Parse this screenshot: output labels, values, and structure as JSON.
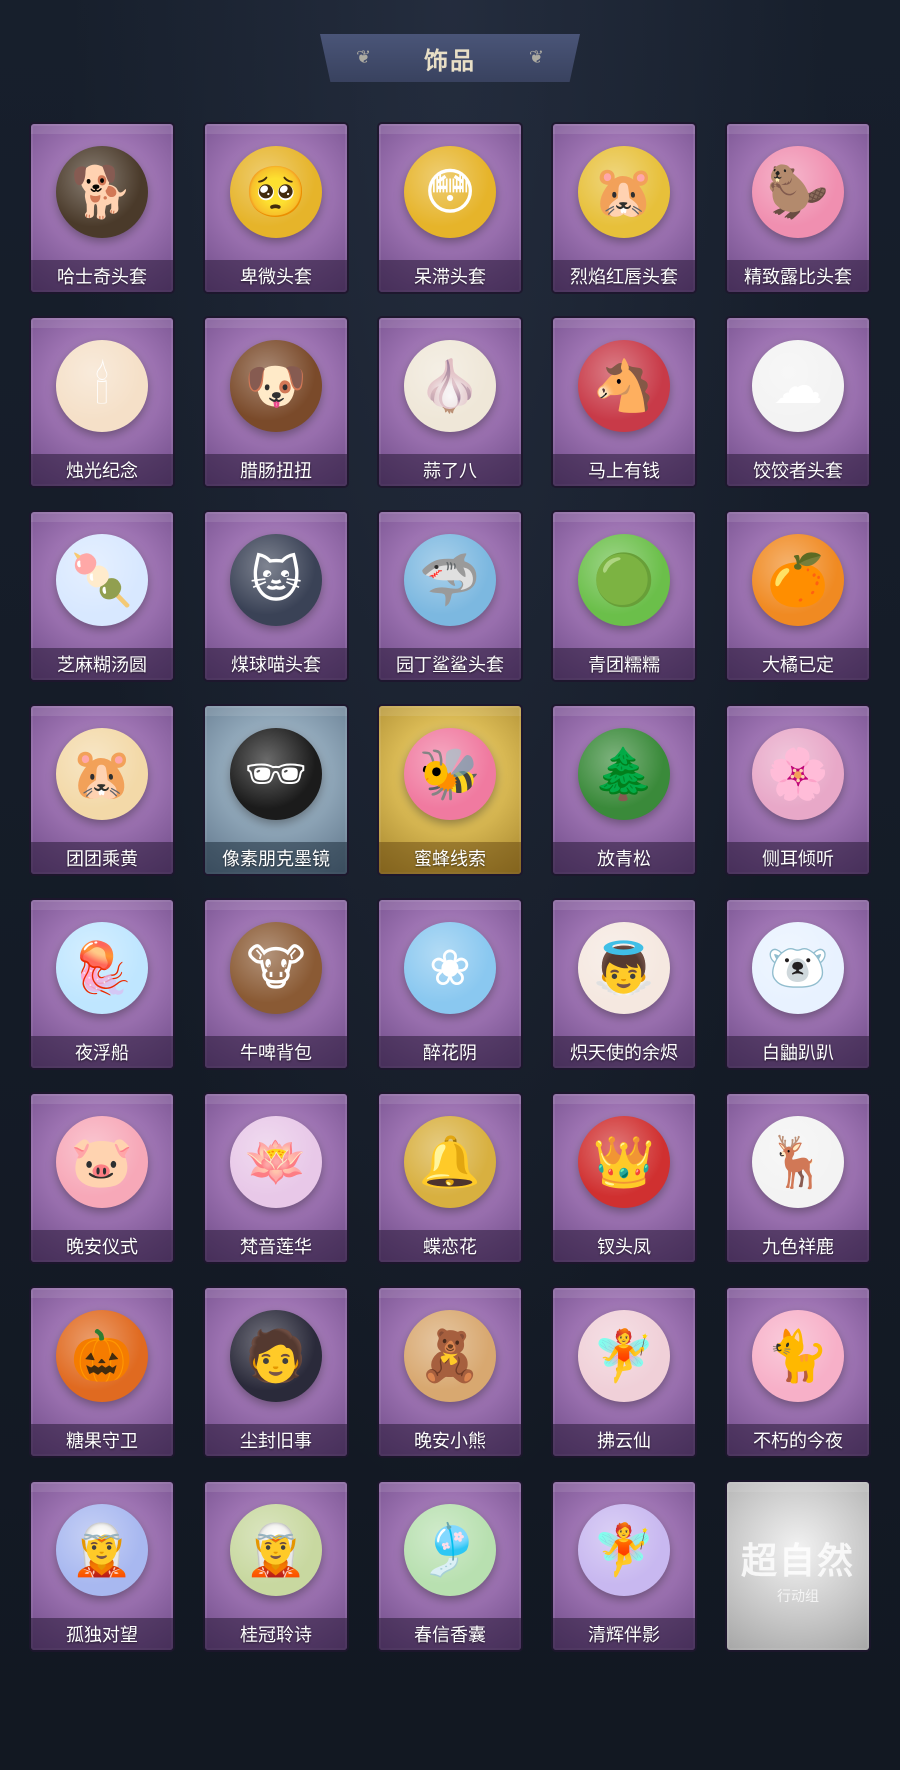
{
  "header": {
    "title": "饰品"
  },
  "items": [
    {
      "label": "哈士奇头套",
      "icon": "husky-head-icon",
      "glyph": "🐕",
      "tint": "#4a3a2a",
      "rarity": "purple"
    },
    {
      "label": "卑微头套",
      "icon": "humble-face-icon",
      "glyph": "🥺",
      "tint": "#e6b42a",
      "rarity": "purple"
    },
    {
      "label": "呆滞头套",
      "icon": "dazed-face-icon",
      "glyph": "😳",
      "tint": "#e6b42a",
      "rarity": "purple"
    },
    {
      "label": "烈焰红唇头套",
      "icon": "red-lips-head-icon",
      "glyph": "🐹",
      "tint": "#e7c03a",
      "rarity": "purple"
    },
    {
      "label": "精致露比头套",
      "icon": "loopy-head-icon",
      "glyph": "🦫",
      "tint": "#f08fb0",
      "rarity": "purple"
    },
    {
      "label": "烛光纪念",
      "icon": "candle-icon",
      "glyph": "🕯",
      "tint": "#f5e0c8",
      "rarity": "purple"
    },
    {
      "label": "腊肠扭扭",
      "icon": "dachshund-icon",
      "glyph": "🐶",
      "tint": "#7a4a2a",
      "rarity": "purple"
    },
    {
      "label": "蒜了八",
      "icon": "garlic-icon",
      "glyph": "🧄",
      "tint": "#efe7d8",
      "rarity": "purple"
    },
    {
      "label": "马上有钱",
      "icon": "horse-icon",
      "glyph": "🐴",
      "tint": "#c83a48",
      "rarity": "purple"
    },
    {
      "label": "饺饺者头套",
      "icon": "dumpling-head-icon",
      "glyph": "☁",
      "tint": "#f3f3f3",
      "rarity": "purple"
    },
    {
      "label": "芝麻糊汤圆",
      "icon": "tangyuan-icon",
      "glyph": "🍡",
      "tint": "#d8e8ff",
      "rarity": "purple"
    },
    {
      "label": "煤球喵头套",
      "icon": "cat-head-icon",
      "glyph": "🐱",
      "tint": "#3a4256",
      "rarity": "purple"
    },
    {
      "label": "园丁鲨鲨头套",
      "icon": "shark-head-icon",
      "glyph": "🦈",
      "tint": "#7cb8e0",
      "rarity": "purple"
    },
    {
      "label": "青团糯糯",
      "icon": "green-dumpling-icon",
      "glyph": "🟢",
      "tint": "#6bbf4a",
      "rarity": "purple"
    },
    {
      "label": "大橘已定",
      "icon": "orange-slice-icon",
      "glyph": "🍊",
      "tint": "#f08a22",
      "rarity": "purple"
    },
    {
      "label": "团团乘黄",
      "icon": "fluffy-beast-icon",
      "glyph": "🐹",
      "tint": "#f3d9a8",
      "rarity": "purple"
    },
    {
      "label": "像素朋克墨镜",
      "icon": "pixel-sunglasses-icon",
      "glyph": "🕶",
      "tint": "#1b1b1b",
      "rarity": "blue"
    },
    {
      "label": "蜜蜂线索",
      "icon": "bee-loopy-icon",
      "glyph": "🐝",
      "tint": "#f07aa0",
      "rarity": "gold"
    },
    {
      "label": "放青松",
      "icon": "bonsai-pine-icon",
      "glyph": "🌲",
      "tint": "#3a8a3a",
      "rarity": "purple"
    },
    {
      "label": "侧耳倾听",
      "icon": "flower-wreath-icon",
      "glyph": "🌸",
      "tint": "#e8a8c8",
      "rarity": "purple"
    },
    {
      "label": "夜浮船",
      "icon": "jellyfish-icon",
      "glyph": "🪼",
      "tint": "#bfe6ff",
      "rarity": "purple"
    },
    {
      "label": "牛啤背包",
      "icon": "cow-barrel-icon",
      "glyph": "🐮",
      "tint": "#8a5a34",
      "rarity": "purple"
    },
    {
      "label": "醉花阴",
      "icon": "ornament-fan-icon",
      "glyph": "❀",
      "tint": "#8ac8f0",
      "rarity": "purple"
    },
    {
      "label": "炽天使的余烬",
      "icon": "angel-doll-icon",
      "glyph": "👼",
      "tint": "#f5e8e0",
      "rarity": "purple"
    },
    {
      "label": "白鼬趴趴",
      "icon": "ermine-plush-icon",
      "glyph": "🐻‍❄",
      "tint": "#e8f2ff",
      "rarity": "purple"
    },
    {
      "label": "晚安仪式",
      "icon": "sleepy-pig-icon",
      "glyph": "🐷",
      "tint": "#f7a8b8",
      "rarity": "purple"
    },
    {
      "label": "梵音莲华",
      "icon": "lotus-doll-icon",
      "glyph": "🪷",
      "tint": "#e8c8e8",
      "rarity": "purple"
    },
    {
      "label": "蝶恋花",
      "icon": "butterfly-bell-icon",
      "glyph": "🔔",
      "tint": "#d8b040",
      "rarity": "purple"
    },
    {
      "label": "钗头凤",
      "icon": "phoenix-crown-icon",
      "glyph": "👑",
      "tint": "#d03030",
      "rarity": "purple"
    },
    {
      "label": "九色祥鹿",
      "icon": "deer-icon",
      "glyph": "🦌",
      "tint": "#f3f3f3",
      "rarity": "purple"
    },
    {
      "label": "糖果守卫",
      "icon": "pumpkin-guard-icon",
      "glyph": "🎃",
      "tint": "#e06a20",
      "rarity": "purple"
    },
    {
      "label": "尘封旧事",
      "icon": "boy-doll-icon",
      "glyph": "🧑",
      "tint": "#2a2a3a",
      "rarity": "purple"
    },
    {
      "label": "晚安小熊",
      "icon": "bear-charm-icon",
      "glyph": "🧸",
      "tint": "#d8a870",
      "rarity": "purple"
    },
    {
      "label": "拂云仙",
      "icon": "fairy-charm-icon",
      "glyph": "🧚",
      "tint": "#f0d0d8",
      "rarity": "purple"
    },
    {
      "label": "不朽的今夜",
      "icon": "pink-cat-cup-icon",
      "glyph": "🐈",
      "tint": "#f7b0c8",
      "rarity": "purple"
    },
    {
      "label": "孤独对望",
      "icon": "blue-doll-icon",
      "glyph": "🧝",
      "tint": "#a8b8f0",
      "rarity": "purple"
    },
    {
      "label": "桂冠聆诗",
      "icon": "laurel-doll-icon",
      "glyph": "🧝",
      "tint": "#c8d8a0",
      "rarity": "purple"
    },
    {
      "label": "春信香囊",
      "icon": "sachet-icon",
      "glyph": "🎐",
      "tint": "#b8e0b0",
      "rarity": "purple"
    },
    {
      "label": "清辉伴影",
      "icon": "moon-doll-icon",
      "glyph": "🧚",
      "tint": "#c8b8f0",
      "rarity": "purple"
    },
    {
      "label": "",
      "icon": "placeholder-logo-icon",
      "glyph": "",
      "tint": "#ffffff",
      "rarity": "white",
      "mark_title": "超自然",
      "mark_sub": "行动组"
    }
  ]
}
